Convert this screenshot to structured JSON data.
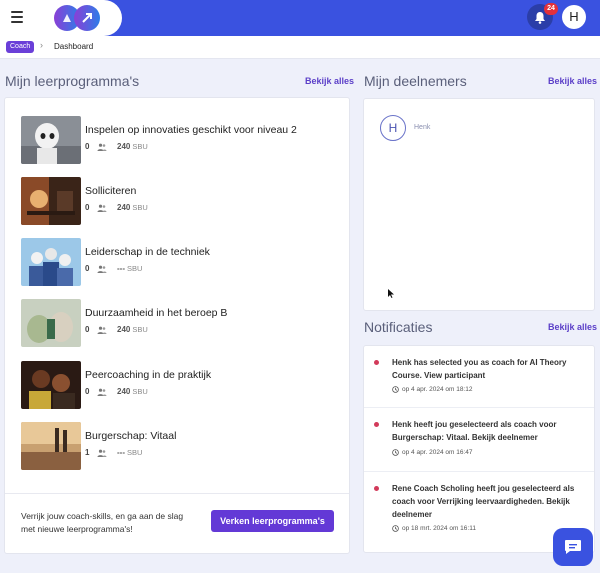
{
  "header": {
    "icons": {
      "menu": "hamburger-icon",
      "logo": "infinity-logo",
      "notifications": "bell-icon"
    },
    "notification_count": "24",
    "user_initial": "H"
  },
  "breadcrumb": {
    "role": "Coach",
    "current": "Dashboard"
  },
  "programs": {
    "title": "Mijn leerprogramma's",
    "see_all": "Bekijk alles",
    "items": [
      {
        "title": "Inspelen op innovaties geschikt voor niveau 2",
        "participants": "0",
        "sbu": "240",
        "sbu_unit": "SBU"
      },
      {
        "title": "Solliciteren",
        "participants": "0",
        "sbu": "240",
        "sbu_unit": "SBU"
      },
      {
        "title": "Leiderschap in de techniek",
        "participants": "0",
        "sbu": "---",
        "sbu_unit": "SBU"
      },
      {
        "title": "Duurzaamheid in het beroep B",
        "participants": "0",
        "sbu": "240",
        "sbu_unit": "SBU"
      },
      {
        "title": "Peercoaching in de praktijk",
        "participants": "0",
        "sbu": "240",
        "sbu_unit": "SBU"
      },
      {
        "title": "Burgerschap: Vitaal",
        "participants": "1",
        "sbu": "---",
        "sbu_unit": "SBU"
      }
    ],
    "footer_text": "Verrijk jouw coach-skills, en ga aan de slag met nieuwe leerprogramma's!",
    "cta_label": "Verken leerprogramma's"
  },
  "participants": {
    "title": "Mijn deelnemers",
    "see_all": "Bekijk alles",
    "items": [
      {
        "initial": "H",
        "name": "Henk"
      }
    ]
  },
  "notifications": {
    "title": "Notificaties",
    "see_all": "Bekijk alles",
    "items": [
      {
        "text": "Henk has selected you as coach for AI Theory Course. View participant",
        "time": "op 4 apr. 2024 om 18:12"
      },
      {
        "text": "Henk heeft jou geselecteerd als coach voor Burgerschap: Vitaal. Bekijk deelnemer",
        "time": "op 4 apr. 2024 om 16:47"
      },
      {
        "text": "Rene Coach Scholing heeft jou geselecteerd als coach voor Verrijking leervaardigheden. Bekijk deelnemer",
        "time": "op 18 mrt. 2024 om 16:11"
      }
    ]
  },
  "colors": {
    "primary": "#3a52e0",
    "accent": "#6339d6",
    "unread_dot": "#d23a5a",
    "badge": "#e3303a"
  }
}
